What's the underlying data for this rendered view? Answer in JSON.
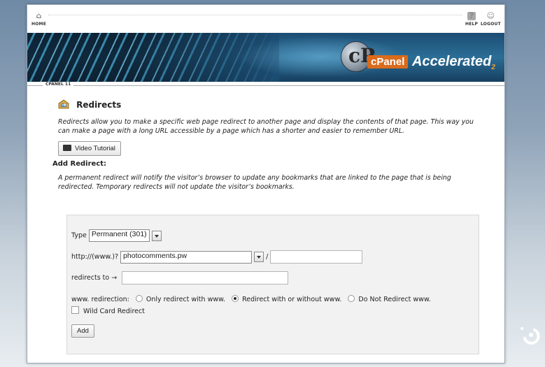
{
  "nav": {
    "home_label": "HOME",
    "help_label": "HELP",
    "logout_label": "LOGOUT"
  },
  "banner": {
    "brand_badge": "cPanel",
    "brand_text": "Accelerated",
    "brand_sub": "2",
    "version_label": "CPANEL 11"
  },
  "page": {
    "title": "Redirects",
    "description": "Redirects allow you to make a specific web page redirect to another page and display the contents of that page. This way you can make a page with a long URL accessible by a page which has a shorter and easier to remember URL.",
    "video_button": "Video Tutorial",
    "add_heading": "Add Redirect:",
    "add_description": "A permanent redirect will notify the visitor’s browser to update any bookmarks that are linked to the page that is being redirected. Temporary redirects will not update the visitor’s bookmarks."
  },
  "form": {
    "type_label": "Type",
    "type_value": "Permanent (301)",
    "domain_prefix": "http://(www.)?",
    "domain_value": "photocomments.pw",
    "path_separator": "/",
    "path_value": "",
    "redirects_to_label": "redirects to →",
    "redirects_to_value": "",
    "www_label": "www. redirection:",
    "www_options": [
      {
        "label": "Only redirect with www.",
        "selected": false
      },
      {
        "label": "Redirect with or without www.",
        "selected": true
      },
      {
        "label": "Do Not Redirect www.",
        "selected": false
      }
    ],
    "wildcard_label": "Wild Card Redirect",
    "wildcard_checked": false,
    "add_button": "Add"
  },
  "colors": {
    "brand_orange": "#d96b1c",
    "banner_blue": "#1c4d73",
    "panel_bg": "#f2f2f2"
  }
}
